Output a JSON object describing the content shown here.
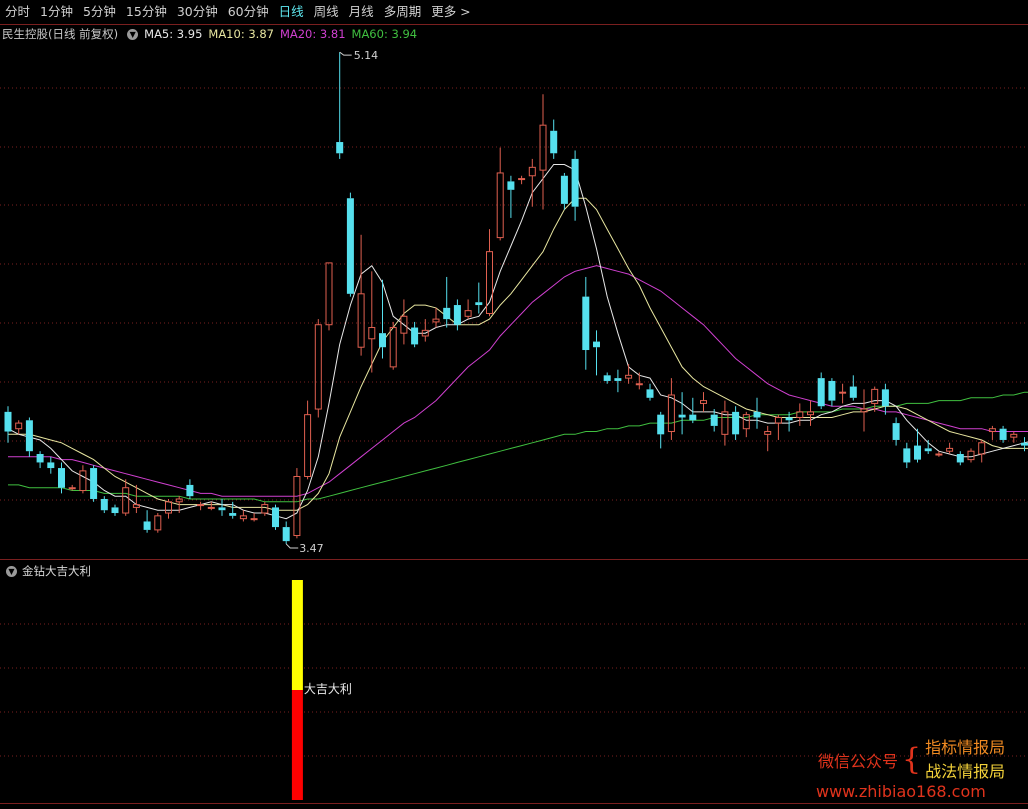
{
  "toolbar": {
    "tabs": [
      "分时",
      "1分钟",
      "5分钟",
      "15分钟",
      "30分钟",
      "60分钟",
      "日线",
      "周线",
      "月线",
      "多周期",
      "更多 >"
    ],
    "active": "日线"
  },
  "stock_legend": {
    "name": "民生控股(日线 前复权)",
    "ma5": "MA5: 3.95",
    "ma10": "MA10: 3.87",
    "ma20": "MA20: 3.81",
    "ma60": "MA60: 3.94"
  },
  "indicator_legend": {
    "name": "金钻大吉大利"
  },
  "watermark": {
    "left": "微信公众号",
    "right1": "指标情报局",
    "right2": "战法情报局",
    "site": "www.zhibiao168.com"
  },
  "colors": {
    "up": "#e06050",
    "down": "#56e0ee",
    "ma5": "#e8e8e8",
    "ma10": "#e8e6a0",
    "ma20": "#d040d0",
    "ma60": "#40c040",
    "grid": "#7a1f1f",
    "signal_yellow": "#ffff00",
    "signal_red": "#ff0000"
  },
  "chart_data": {
    "type": "candlestick",
    "price_range": [
      3.34,
      5.24
    ],
    "high_marker": "5.14",
    "low_marker": "3.47",
    "ohlc": [
      [
        3.86,
        3.88,
        3.75,
        3.79
      ],
      [
        3.8,
        3.83,
        3.78,
        3.82
      ],
      [
        3.83,
        3.84,
        3.7,
        3.72
      ],
      [
        3.71,
        3.72,
        3.66,
        3.68
      ],
      [
        3.68,
        3.7,
        3.64,
        3.66
      ],
      [
        3.66,
        3.68,
        3.57,
        3.59
      ],
      [
        3.59,
        3.6,
        3.58,
        3.59
      ],
      [
        3.58,
        3.67,
        3.57,
        3.65
      ],
      [
        3.66,
        3.67,
        3.54,
        3.55
      ],
      [
        3.55,
        3.56,
        3.5,
        3.51
      ],
      [
        3.52,
        3.53,
        3.49,
        3.5
      ],
      [
        3.5,
        3.62,
        3.49,
        3.59
      ],
      [
        3.52,
        3.6,
        3.5,
        3.53
      ],
      [
        3.47,
        3.51,
        3.43,
        3.44
      ],
      [
        3.44,
        3.5,
        3.43,
        3.49
      ],
      [
        3.5,
        3.55,
        3.48,
        3.54
      ],
      [
        3.54,
        3.56,
        3.5,
        3.55
      ],
      [
        3.6,
        3.62,
        3.55,
        3.56
      ],
      [
        3.53,
        3.54,
        3.51,
        3.53
      ],
      [
        3.52,
        3.54,
        3.51,
        3.52
      ],
      [
        3.52,
        3.55,
        3.49,
        3.51
      ],
      [
        3.5,
        3.54,
        3.48,
        3.49
      ],
      [
        3.48,
        3.51,
        3.47,
        3.49
      ],
      [
        3.48,
        3.5,
        3.47,
        3.48
      ],
      [
        3.5,
        3.54,
        3.49,
        3.53
      ],
      [
        3.52,
        3.53,
        3.44,
        3.45
      ],
      [
        3.45,
        3.47,
        3.39,
        3.4
      ],
      [
        3.42,
        3.66,
        3.41,
        3.63
      ],
      [
        3.63,
        3.9,
        3.62,
        3.85
      ],
      [
        3.87,
        4.19,
        3.84,
        4.17
      ],
      [
        4.17,
        4.39,
        4.15,
        4.39
      ],
      [
        4.82,
        5.14,
        4.76,
        4.78
      ],
      [
        4.62,
        4.64,
        4.27,
        4.28
      ],
      [
        4.09,
        4.49,
        4.06,
        4.28
      ],
      [
        4.12,
        4.36,
        4.0,
        4.16
      ],
      [
        4.14,
        4.33,
        4.05,
        4.09
      ],
      [
        4.02,
        4.18,
        4.01,
        4.16
      ],
      [
        4.14,
        4.26,
        4.1,
        4.2
      ],
      [
        4.16,
        4.18,
        4.09,
        4.1
      ],
      [
        4.13,
        4.19,
        4.11,
        4.15
      ],
      [
        4.18,
        4.23,
        4.16,
        4.19
      ],
      [
        4.23,
        4.34,
        4.16,
        4.19
      ],
      [
        4.24,
        4.26,
        4.15,
        4.17
      ],
      [
        4.2,
        4.26,
        4.19,
        4.22
      ],
      [
        4.25,
        4.32,
        4.21,
        4.24
      ],
      [
        4.21,
        4.51,
        4.2,
        4.43
      ],
      [
        4.48,
        4.8,
        4.47,
        4.71
      ],
      [
        4.68,
        4.7,
        4.55,
        4.65
      ],
      [
        4.69,
        4.7,
        4.67,
        4.69
      ],
      [
        4.7,
        4.76,
        4.59,
        4.73
      ],
      [
        4.72,
        4.99,
        4.58,
        4.88
      ],
      [
        4.86,
        4.9,
        4.76,
        4.78
      ],
      [
        4.7,
        4.71,
        4.58,
        4.6
      ],
      [
        4.76,
        4.79,
        4.54,
        4.59
      ],
      [
        4.27,
        4.34,
        4.01,
        4.08
      ],
      [
        4.11,
        4.15,
        3.99,
        4.09
      ],
      [
        3.99,
        4.0,
        3.96,
        3.97
      ],
      [
        3.98,
        4.01,
        3.93,
        3.97
      ],
      [
        3.98,
        4.03,
        3.96,
        3.99
      ],
      [
        3.96,
        4.0,
        3.94,
        3.96
      ],
      [
        3.94,
        3.96,
        3.9,
        3.91
      ],
      [
        3.85,
        3.86,
        3.73,
        3.78
      ],
      [
        3.79,
        3.98,
        3.76,
        3.92
      ],
      [
        3.85,
        3.93,
        3.78,
        3.84
      ],
      [
        3.85,
        3.91,
        3.82,
        3.83
      ],
      [
        3.89,
        3.93,
        3.86,
        3.9
      ],
      [
        3.85,
        3.87,
        3.79,
        3.81
      ],
      [
        3.78,
        3.9,
        3.74,
        3.86
      ],
      [
        3.86,
        3.88,
        3.76,
        3.78
      ],
      [
        3.8,
        3.86,
        3.77,
        3.85
      ],
      [
        3.86,
        3.91,
        3.8,
        3.84
      ],
      [
        3.78,
        3.81,
        3.72,
        3.79
      ],
      [
        3.82,
        3.85,
        3.76,
        3.84
      ],
      [
        3.84,
        3.86,
        3.79,
        3.83
      ],
      [
        3.84,
        3.89,
        3.81,
        3.86
      ],
      [
        3.85,
        3.9,
        3.81,
        3.86
      ],
      [
        3.98,
        4.0,
        3.87,
        3.88
      ],
      [
        3.97,
        3.98,
        3.88,
        3.9
      ],
      [
        3.93,
        3.96,
        3.89,
        3.93
      ],
      [
        3.95,
        3.99,
        3.9,
        3.91
      ],
      [
        3.86,
        3.94,
        3.79,
        3.87
      ],
      [
        3.89,
        3.95,
        3.86,
        3.94
      ],
      [
        3.94,
        3.96,
        3.85,
        3.88
      ],
      [
        3.82,
        3.84,
        3.74,
        3.76
      ],
      [
        3.73,
        3.75,
        3.66,
        3.68
      ],
      [
        3.74,
        3.8,
        3.68,
        3.69
      ],
      [
        3.73,
        3.76,
        3.71,
        3.72
      ],
      [
        3.71,
        3.72,
        3.7,
        3.71
      ],
      [
        3.72,
        3.75,
        3.71,
        3.73
      ],
      [
        3.71,
        3.72,
        3.67,
        3.68
      ],
      [
        3.69,
        3.73,
        3.68,
        3.72
      ],
      [
        3.71,
        3.76,
        3.68,
        3.75
      ],
      [
        3.79,
        3.81,
        3.76,
        3.8
      ],
      [
        3.8,
        3.81,
        3.75,
        3.76
      ],
      [
        3.77,
        3.79,
        3.75,
        3.78
      ],
      [
        3.75,
        3.77,
        3.72,
        3.74
      ],
      [
        3.75,
        3.77,
        3.66,
        3.73
      ],
      [
        3.74,
        3.79,
        3.72,
        3.76
      ]
    ],
    "ma5": [
      3.8,
      3.78,
      3.77,
      3.76,
      3.73,
      3.69,
      3.65,
      3.63,
      3.61,
      3.58,
      3.56,
      3.56,
      3.53,
      3.52,
      3.51,
      3.51,
      3.51,
      3.52,
      3.53,
      3.54,
      3.53,
      3.53,
      3.51,
      3.5,
      3.5,
      3.49,
      3.48,
      3.5,
      3.58,
      3.7,
      3.89,
      4.1,
      4.24,
      4.35,
      4.38,
      4.32,
      4.2,
      4.17,
      4.14,
      4.14,
      4.16,
      4.17,
      4.17,
      4.19,
      4.2,
      4.25,
      4.36,
      4.45,
      4.54,
      4.64,
      4.69,
      4.74,
      4.74,
      4.72,
      4.59,
      4.44,
      4.27,
      4.14,
      4.02,
      3.99,
      3.98,
      3.92,
      3.91,
      3.89,
      3.86,
      3.86,
      3.86,
      3.85,
      3.85,
      3.83,
      3.83,
      3.82,
      3.82,
      3.82,
      3.83,
      3.83,
      3.85,
      3.86,
      3.88,
      3.89,
      3.89,
      3.9,
      3.9,
      3.88,
      3.83,
      3.79,
      3.75,
      3.72,
      3.71,
      3.7,
      3.7,
      3.71,
      3.72,
      3.73,
      3.74,
      3.75,
      3.76,
      3.76
    ],
    "ma10": [
      3.78,
      3.78,
      3.78,
      3.77,
      3.76,
      3.75,
      3.73,
      3.71,
      3.69,
      3.66,
      3.63,
      3.61,
      3.59,
      3.57,
      3.55,
      3.54,
      3.53,
      3.53,
      3.53,
      3.53,
      3.53,
      3.52,
      3.52,
      3.52,
      3.52,
      3.51,
      3.51,
      3.51,
      3.53,
      3.57,
      3.64,
      3.77,
      3.86,
      3.95,
      4.03,
      4.11,
      4.16,
      4.21,
      4.24,
      4.24,
      4.23,
      4.2,
      4.17,
      4.17,
      4.17,
      4.19,
      4.24,
      4.28,
      4.33,
      4.38,
      4.43,
      4.51,
      4.58,
      4.62,
      4.62,
      4.58,
      4.51,
      4.44,
      4.37,
      4.31,
      4.23,
      4.16,
      4.09,
      4.02,
      3.98,
      3.95,
      3.93,
      3.91,
      3.89,
      3.87,
      3.86,
      3.85,
      3.84,
      3.84,
      3.84,
      3.84,
      3.84,
      3.84,
      3.85,
      3.86,
      3.86,
      3.87,
      3.88,
      3.88,
      3.87,
      3.85,
      3.83,
      3.81,
      3.79,
      3.78,
      3.77,
      3.76,
      3.74,
      3.73,
      3.73,
      3.73,
      3.73,
      3.74
    ],
    "ma20": [
      3.7,
      3.7,
      3.7,
      3.7,
      3.7,
      3.69,
      3.69,
      3.68,
      3.67,
      3.66,
      3.65,
      3.64,
      3.63,
      3.62,
      3.61,
      3.6,
      3.59,
      3.58,
      3.57,
      3.57,
      3.56,
      3.56,
      3.56,
      3.56,
      3.56,
      3.56,
      3.56,
      3.56,
      3.57,
      3.59,
      3.61,
      3.64,
      3.67,
      3.7,
      3.73,
      3.76,
      3.79,
      3.82,
      3.84,
      3.87,
      3.9,
      3.94,
      3.98,
      4.02,
      4.05,
      4.08,
      4.13,
      4.17,
      4.21,
      4.25,
      4.28,
      4.31,
      4.34,
      4.36,
      4.37,
      4.38,
      4.37,
      4.36,
      4.35,
      4.33,
      4.31,
      4.29,
      4.26,
      4.23,
      4.2,
      4.17,
      4.13,
      4.09,
      4.05,
      4.02,
      3.99,
      3.96,
      3.94,
      3.92,
      3.91,
      3.9,
      3.89,
      3.88,
      3.88,
      3.88,
      3.87,
      3.87,
      3.86,
      3.86,
      3.85,
      3.84,
      3.83,
      3.82,
      3.81,
      3.8,
      3.8,
      3.8,
      3.79,
      3.79,
      3.79,
      3.79,
      3.79,
      3.8
    ],
    "ma60": [
      3.6,
      3.6,
      3.59,
      3.59,
      3.59,
      3.59,
      3.58,
      3.58,
      3.58,
      3.57,
      3.57,
      3.57,
      3.56,
      3.56,
      3.56,
      3.56,
      3.56,
      3.55,
      3.55,
      3.55,
      3.55,
      3.55,
      3.55,
      3.55,
      3.54,
      3.54,
      3.54,
      3.54,
      3.55,
      3.55,
      3.56,
      3.57,
      3.58,
      3.59,
      3.6,
      3.61,
      3.62,
      3.63,
      3.64,
      3.65,
      3.66,
      3.67,
      3.68,
      3.69,
      3.7,
      3.71,
      3.72,
      3.73,
      3.74,
      3.75,
      3.76,
      3.77,
      3.78,
      3.78,
      3.79,
      3.79,
      3.8,
      3.8,
      3.81,
      3.81,
      3.82,
      3.82,
      3.82,
      3.83,
      3.83,
      3.83,
      3.84,
      3.84,
      3.84,
      3.84,
      3.85,
      3.85,
      3.85,
      3.85,
      3.86,
      3.86,
      3.86,
      3.86,
      3.87,
      3.87,
      3.87,
      3.88,
      3.88,
      3.88,
      3.89,
      3.89,
      3.89,
      3.9,
      3.9,
      3.9,
      3.91,
      3.91,
      3.91,
      3.92,
      3.92,
      3.93,
      3.93,
      3.94
    ],
    "signal": {
      "index": 27,
      "label": "大吉大利",
      "yellow_fraction": 0.5
    }
  }
}
